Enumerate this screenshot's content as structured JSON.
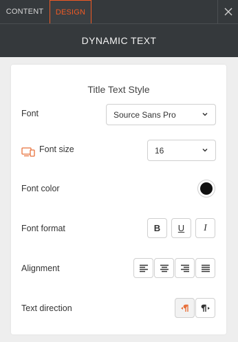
{
  "tabs": {
    "content": "CONTENT",
    "design": "DESIGN"
  },
  "header": {
    "title": "DYNAMIC TEXT"
  },
  "section": {
    "title": "Title Text Style"
  },
  "font": {
    "label": "Font",
    "value": "Source Sans Pro"
  },
  "font_size": {
    "label": "Font size",
    "value": "16"
  },
  "font_color": {
    "label": "Font color",
    "value": "#111111"
  },
  "font_format": {
    "label": "Font format",
    "bold": "B",
    "underline": "U",
    "italic": "I"
  },
  "alignment": {
    "label": "Alignment",
    "options": [
      "left",
      "center",
      "right",
      "justify"
    ]
  },
  "text_direction": {
    "label": "Text direction",
    "options": [
      "rtl",
      "ltr"
    ],
    "selected": "rtl"
  },
  "colors": {
    "accent": "#f15a24",
    "header_bg": "#35393c",
    "panel_bg": "#eeeeee",
    "icon_orange": "#e8703a"
  }
}
